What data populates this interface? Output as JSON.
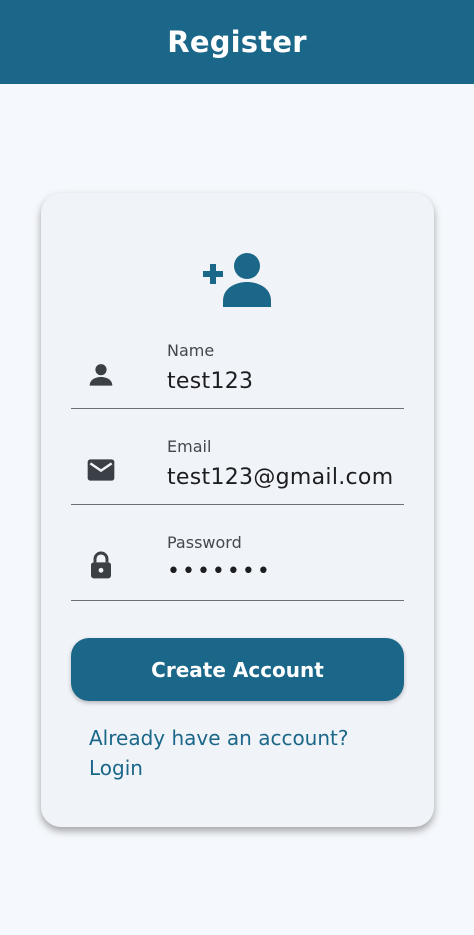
{
  "appbar": {
    "title": "Register"
  },
  "form": {
    "hero_icon": "person-add-icon",
    "fields": [
      {
        "label": "Name",
        "value": "test123",
        "icon": "person-icon"
      },
      {
        "label": "Email",
        "value": "test123@gmail.com",
        "icon": "mail-icon"
      },
      {
        "label": "Password",
        "value": "•••••••",
        "icon": "lock-icon"
      }
    ],
    "submit_label": "Create Account",
    "login_prompt": "Already have an account? Login"
  },
  "colors": {
    "primary": "#1b6789",
    "background": "#f5f8fc",
    "card": "#f0f3f8",
    "icon_dark": "#3b4047"
  }
}
